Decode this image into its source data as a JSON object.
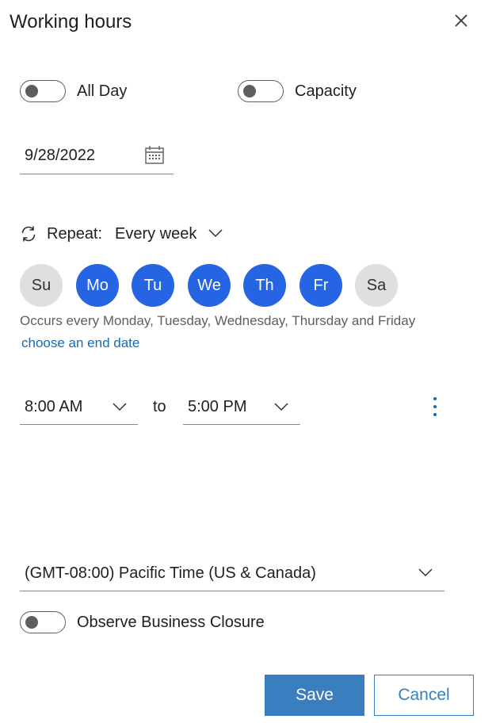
{
  "dialog": {
    "title": "Working hours"
  },
  "toggles": {
    "all_day": {
      "label": "All Day",
      "on": false
    },
    "capacity": {
      "label": "Capacity",
      "on": false
    },
    "observe_closure": {
      "label": "Observe Business Closure",
      "on": false
    }
  },
  "date": {
    "value": "9/28/2022"
  },
  "repeat": {
    "label": "Repeat:",
    "value": "Every week"
  },
  "days": [
    {
      "label": "Su",
      "selected": false
    },
    {
      "label": "Mo",
      "selected": true
    },
    {
      "label": "Tu",
      "selected": true
    },
    {
      "label": "We",
      "selected": true
    },
    {
      "label": "Th",
      "selected": true
    },
    {
      "label": "Fr",
      "selected": true
    },
    {
      "label": "Sa",
      "selected": false
    }
  ],
  "occurs_text": "Occurs every Monday, Tuesday, Wednesday, Thursday and Friday",
  "end_date_link": "choose an end date",
  "time": {
    "start": "8:00 AM",
    "separator": "to",
    "end": "5:00 PM"
  },
  "timezone": {
    "value": "(GMT-08:00) Pacific Time (US & Canada)"
  },
  "buttons": {
    "save": "Save",
    "cancel": "Cancel"
  },
  "colors": {
    "accent": "#2564e3",
    "button": "#3a7ebf",
    "link": "#0f6cbd"
  }
}
